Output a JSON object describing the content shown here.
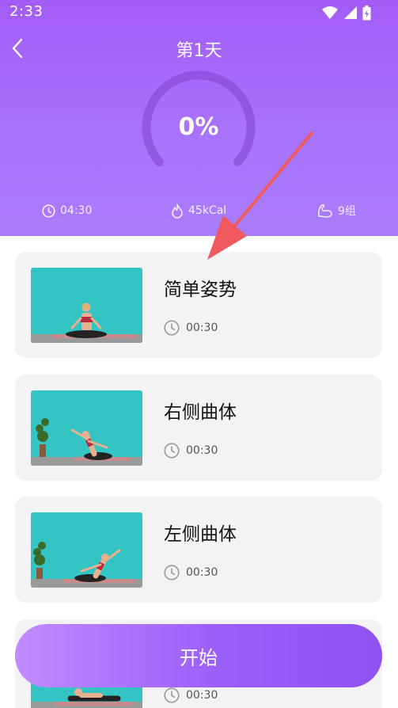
{
  "status_bar": {
    "time": "2:33"
  },
  "header": {
    "title": "第1天",
    "progress": "0%",
    "stats": {
      "duration": "04:30",
      "calories": "45kCal",
      "groups": "9组"
    }
  },
  "exercises": [
    {
      "name": "简单姿势",
      "duration": "00:30"
    },
    {
      "name": "右侧曲体",
      "duration": "00:30"
    },
    {
      "name": "左侧曲体",
      "duration": "00:30"
    },
    {
      "name": "",
      "duration": "00:30"
    }
  ],
  "start_button": {
    "label": "开始"
  },
  "colors": {
    "header_gradient_top": "#a35cf7",
    "header_gradient_bottom": "#a97dfc",
    "card_background": "#f3f3f6",
    "button_gradient_start": "#c08cfd",
    "button_gradient_end": "#8e52f4",
    "thumbnail_wall": "#34c4c4",
    "annotation_arrow": "#f05a5e"
  },
  "icons": {
    "back": "chevron-left-icon",
    "duration": "clock-icon",
    "calories": "flame-icon",
    "groups": "muscle-icon",
    "wifi": "wifi-icon",
    "signal": "signal-icon",
    "battery": "battery-icon"
  }
}
